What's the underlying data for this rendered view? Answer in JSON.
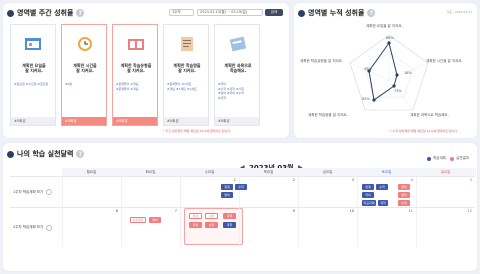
{
  "weekly": {
    "title": "영역별 주간 성취율",
    "select_value": "3주차",
    "date_range": "2023.03.13(월) ~ 03.19(일)",
    "button": "검색",
    "cards": [
      {
        "text": "계획한 요일을\n잘 지켜요.",
        "tags": "#월요일 #수요일 #금요일",
        "foot": "#0회성",
        "highlight": false
      },
      {
        "text": "계획한 시간을\n잘 지켜요.",
        "tags": "#0분",
        "foot": "#0회성",
        "highlight": true
      },
      {
        "text": "계획한 학습유형을\n잘 지켜요.",
        "tags": "#문제풀이 #개념\n#문제풀이 #개념",
        "foot": "#0회성",
        "highlight": true
      },
      {
        "text": "계획한 학습량을\n잘 지켜요.",
        "tags": "#문제풀이 #1세트\n#개념 #1세트 #1세트",
        "foot": "#0회성",
        "highlight": false
      },
      {
        "text": "계획한 과목으로\n학습해요.",
        "tags": "#국어\n#수학 #과학 #사회\n#영어 #국어 #수학\n#과학",
        "foot": "#0회성",
        "highlight": false
      }
    ],
    "note": "* 주간 성취율은 매일 목요일 12시에 업데이트 됩니다."
  },
  "cumulative": {
    "title": "영역별 누적 성취율",
    "date": "기준 : 2023.03.17",
    "labels": [
      "계획한 요일을 잘 지켜요.",
      "계획한 시간을 잘 지켜요.",
      "계획한 과목으로 학습해요.",
      "계획한 학습량을 잘 지켜요.",
      "계획한 학습유형을 잘 지켜요."
    ],
    "values": [
      "68%",
      "18%",
      "73%",
      "62%",
      "45%"
    ],
    "note": "* 누적 성취율은 매일 목요일 12시에 업데이트 됩니다."
  },
  "calendar": {
    "title": "나의 학습 실천달력",
    "month": "2023년 03월",
    "legend": [
      {
        "label": "학습계획",
        "color": "#3f57a8"
      },
      {
        "label": "실천결과",
        "color": "#ef7f7f"
      }
    ],
    "days": [
      "월요일",
      "화요일",
      "수요일",
      "목요일",
      "금요일",
      "토요일",
      "일요일"
    ],
    "weeks": [
      {
        "label": "1주차 학습계획 보기",
        "dates": [
          "",
          "",
          "1",
          "2",
          "3",
          "4",
          "5"
        ]
      },
      {
        "label": "2주차 학습계획 보기",
        "dates": [
          "6",
          "7",
          "8",
          "9",
          "10",
          "11",
          "12"
        ]
      }
    ],
    "chips": {
      "w1_wed_1": "정계",
      "w1_wed_2": "수학",
      "w1_wed_3": "영어",
      "w1_sat_1": "정계",
      "w1_sat_2": "수학",
      "w1_sat_3": "영어",
      "w1_sat_4": "국어",
      "w1_sat_5": "학교과제",
      "w1_sat_6": "과학",
      "w1_sat_7": "수학",
      "w1_sat_8": "영어",
      "w2_tue_1": "실천결과",
      "w2_tue_2": "영어",
      "w2_wed_1": "정계",
      "w2_wed_2": "수학",
      "w2_wed_3": "과학",
      "w2_wed_4": "학계",
      "w2_wed_5": "수학",
      "w2_wed_6": "과학",
      "w2_wed_7": "영어",
      "w2_sat_1": "수학",
      "w2_sat_2": "국어"
    }
  }
}
